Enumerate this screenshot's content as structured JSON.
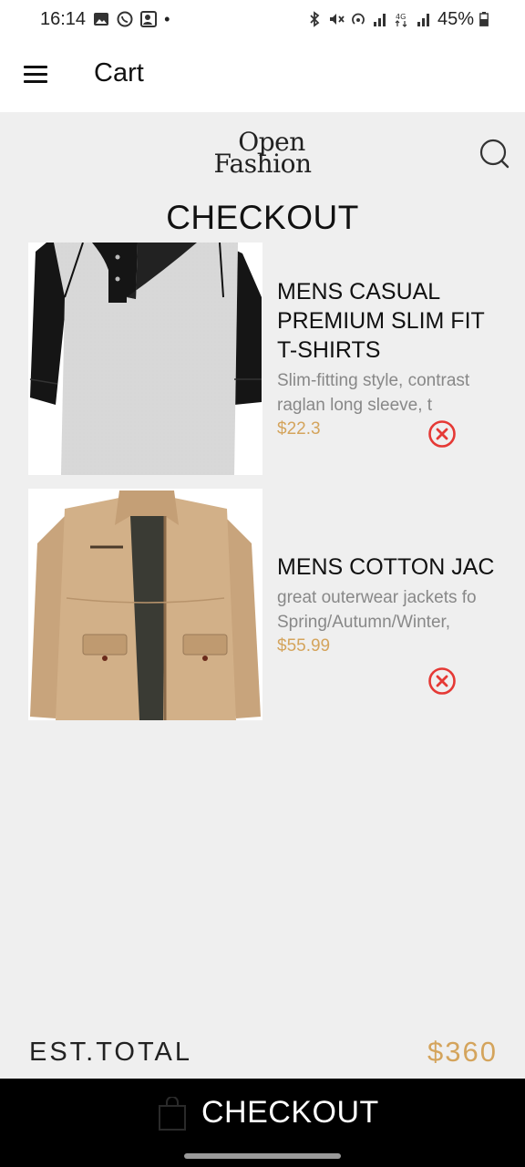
{
  "status_bar": {
    "time": "16:14",
    "battery": "45%"
  },
  "app_bar": {
    "title": "Cart",
    "menu_icon": "hamburger-menu-icon"
  },
  "brand": {
    "line1": "Open",
    "line2": "Fashion"
  },
  "search": {
    "icon": "search-icon"
  },
  "page_heading": "CHECKOUT",
  "cart_items": [
    {
      "title": "MENS CASUAL PREMIUM SLIM FIT T-SHIRTS",
      "title_lines": [
        "MENS CASUAL",
        "PREMIUM SLIM FIT",
        "T-SHIRTS"
      ],
      "description_lines": [
        "Slim-fitting style, contrast",
        "raglan long sleeve, t"
      ],
      "price": "$22.3",
      "image": "grey-raglan-henley-shirt",
      "remove_icon": "remove-circle-x-icon"
    },
    {
      "title": "MENS COTTON JAC",
      "title_lines": [
        "MENS COTTON JAC"
      ],
      "description_lines": [
        "great outerwear jackets fo",
        "Spring/Autumn/Winter,"
      ],
      "price": "$55.99",
      "image": "khaki-cotton-jacket",
      "remove_icon": "remove-circle-x-icon"
    }
  ],
  "total": {
    "label": "EST.TOTAL",
    "value": "$360"
  },
  "checkout_button": {
    "label": "CHECKOUT",
    "icon": "shopping-bag-icon"
  },
  "colors": {
    "accent_gold": "#d4a45c",
    "remove_red": "#e53935",
    "checkout_bg": "#000000",
    "page_bg": "#efefef"
  }
}
